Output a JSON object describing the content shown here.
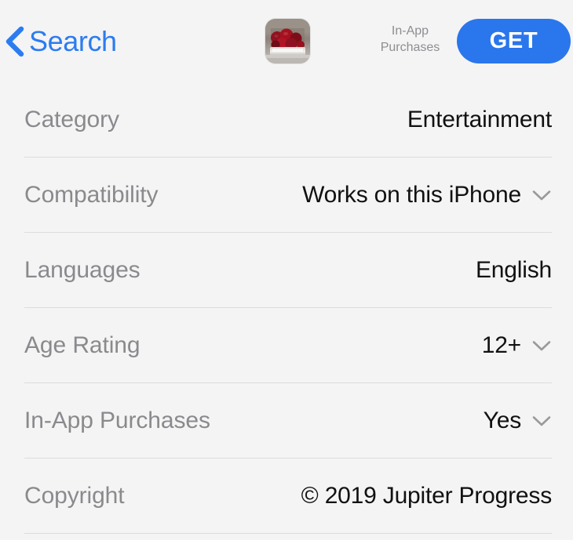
{
  "navbar": {
    "back_label": "Search",
    "back_icon": "chevron-left-icon",
    "accent_color": "#2b7cf0",
    "app_icon": {
      "icon_name": "app-icon-thumbnail",
      "description": "red berries in a glass jar"
    },
    "iap_note_line1": "In-App",
    "iap_note_line2": "Purchases",
    "get_button_label": "GET",
    "get_button_color": "#2a76ec"
  },
  "info_rows": [
    {
      "label": "Category",
      "value": "Entertainment",
      "has_disclosure": false
    },
    {
      "label": "Compatibility",
      "value": "Works on this iPhone",
      "has_disclosure": true
    },
    {
      "label": "Languages",
      "value": "English",
      "has_disclosure": false
    },
    {
      "label": "Age Rating",
      "value": "12+",
      "has_disclosure": true
    },
    {
      "label": "In-App Purchases",
      "value": "Yes",
      "has_disclosure": true
    },
    {
      "label": "Copyright",
      "value": "© 2019 Jupiter Progress",
      "has_disclosure": false
    }
  ],
  "colors": {
    "background": "#f4f4f4",
    "label_text": "#8a8a8e",
    "value_text": "#111111",
    "separator": "#dcdcdc",
    "disclosure_icon": "#9a9a9e"
  }
}
